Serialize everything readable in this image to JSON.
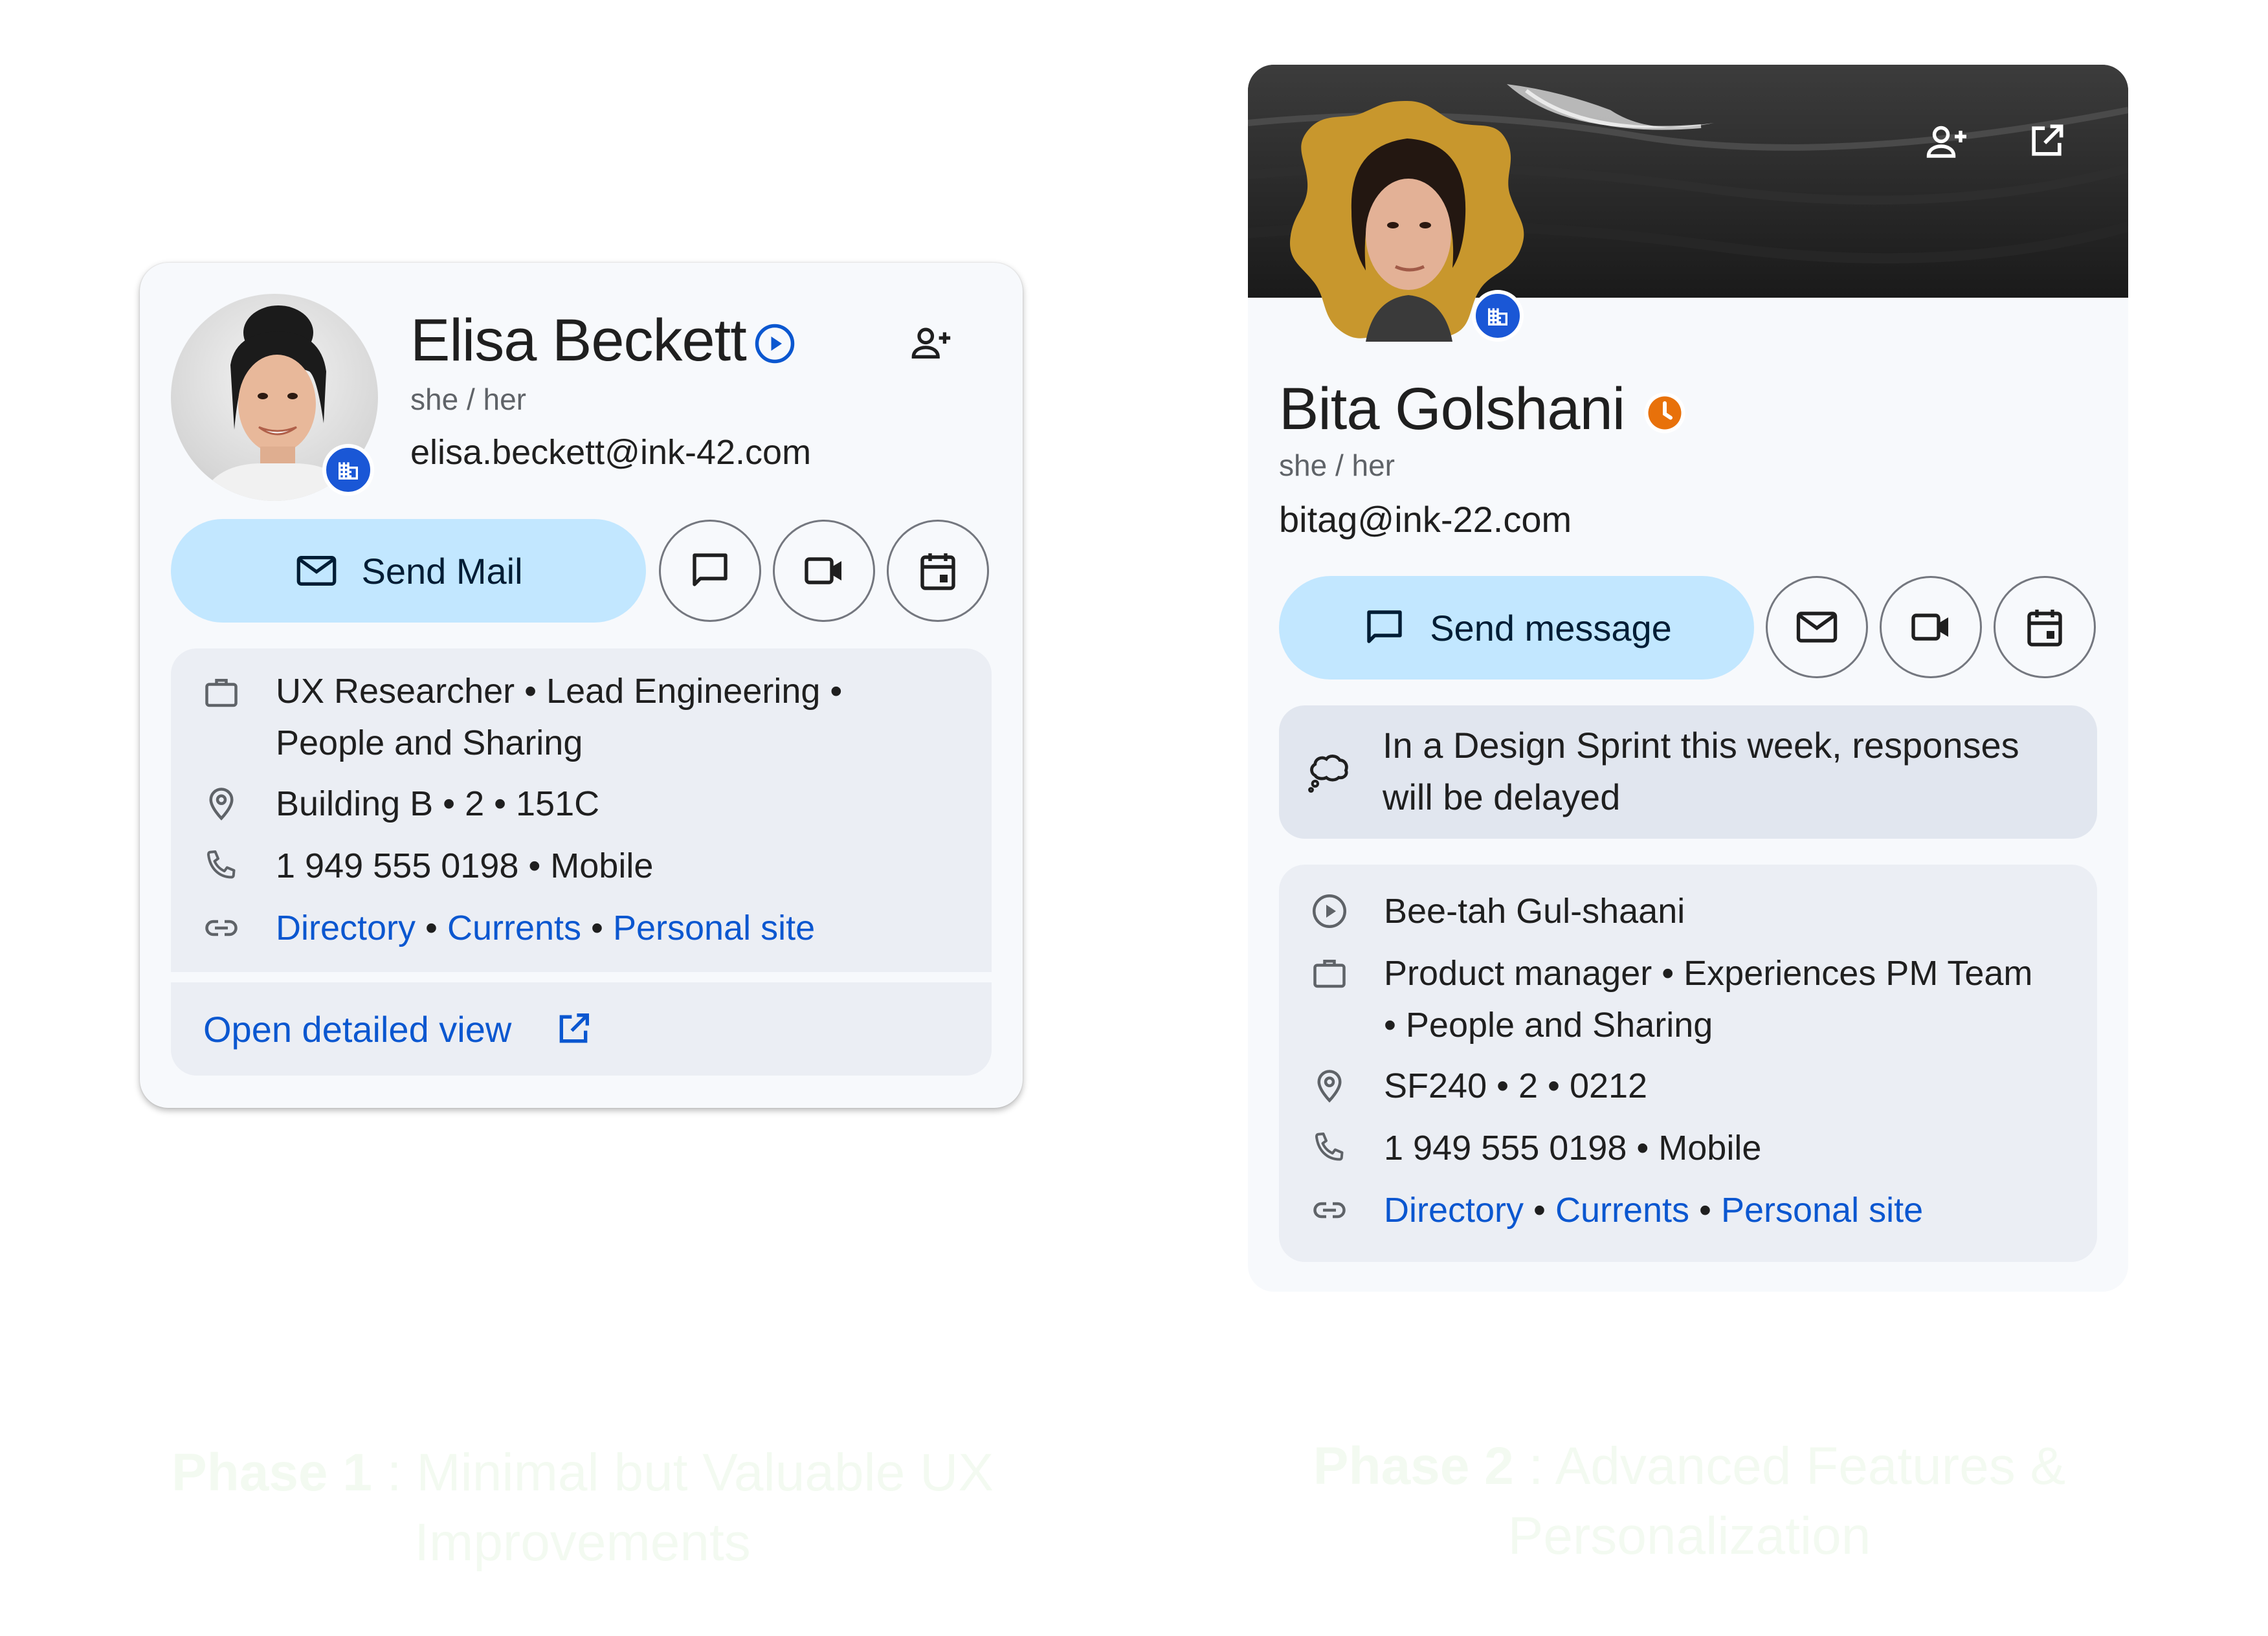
{
  "card1": {
    "name": "Elisa Beckett",
    "pronouns": "she / her",
    "email": "elisa.beckett@ink-42.com",
    "primary_action": "Send Mail",
    "info": {
      "job_line1": "UX Researcher • Lead Engineering •",
      "job_line2": "People and Sharing",
      "location": "Building B • 2 • 151C",
      "phone": "1 949 555 0198 • Mobile",
      "links": [
        "Directory",
        "Currents",
        "Personal site"
      ],
      "separator": " • "
    },
    "open_detailed_view": "Open detailed view"
  },
  "card2": {
    "name": "Bita Golshani",
    "pronouns": "she / her",
    "email": "bitag@ink-22.com",
    "primary_action": "Send message",
    "status_message": "In a Design Sprint this week, responses will be delayed",
    "info": {
      "pronunciation": "Bee-tah Gul-shaani",
      "job_line1": "Product manager • Experiences PM Team",
      "job_line2": "• People and Sharing",
      "location": "SF240 • 2 • 0212",
      "phone": "1 949 555 0198 • Mobile",
      "links": [
        "Directory",
        "Currents",
        "Personal site"
      ],
      "separator": " • "
    }
  },
  "captions": {
    "phase1_label": "Phase 1",
    "phase1_text": " : Minimal but Valuable UX",
    "phase1_text2": "Improvements",
    "phase2_label": "Phase 2",
    "phase2_text": " : Advanced Features &",
    "phase2_text2": "Personalization"
  },
  "colors": {
    "primary_button": "#c2e7ff",
    "link": "#0b57d0",
    "badge": "#1a57d6",
    "clock_badge": "#e8710a",
    "card_bg": "#f7f9fc",
    "section_bg": "#ebeef4",
    "caption": "#f3faf1"
  },
  "icons": [
    "play-circle-icon",
    "add-person-icon",
    "mail-icon",
    "chat-icon",
    "video-icon",
    "calendar-icon",
    "briefcase-icon",
    "location-pin-icon",
    "phone-icon",
    "link-icon",
    "open-external-icon",
    "building-icon",
    "clock-icon",
    "thought-bubble-icon"
  ]
}
